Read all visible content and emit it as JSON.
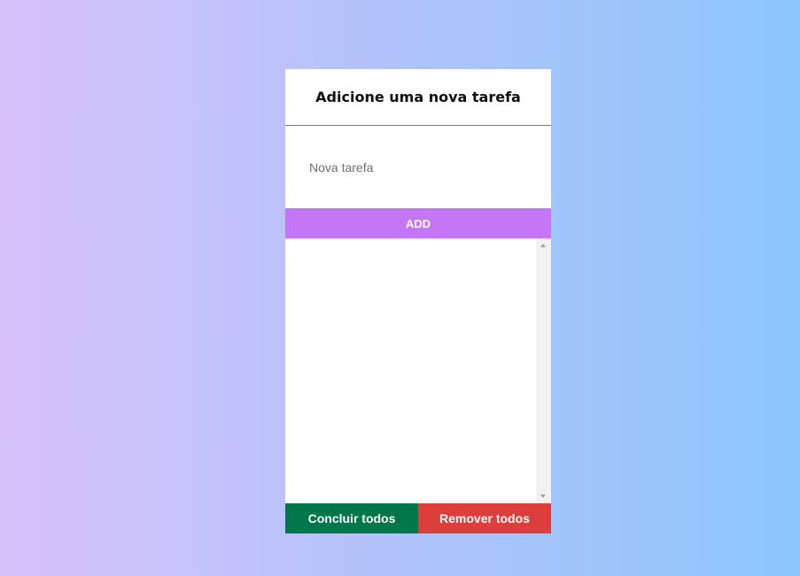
{
  "header": {
    "title": "Adicione uma nova tarefa"
  },
  "input": {
    "value": "",
    "placeholder": "Nova tarefa"
  },
  "add_button": {
    "label": "ADD",
    "color": "#c476f7"
  },
  "task_list": {
    "items": []
  },
  "footer": {
    "complete_all_label": "Concluir todos",
    "complete_all_color": "#00774b",
    "remove_all_label": "Remover todos",
    "remove_all_color": "#dc3e3c"
  }
}
